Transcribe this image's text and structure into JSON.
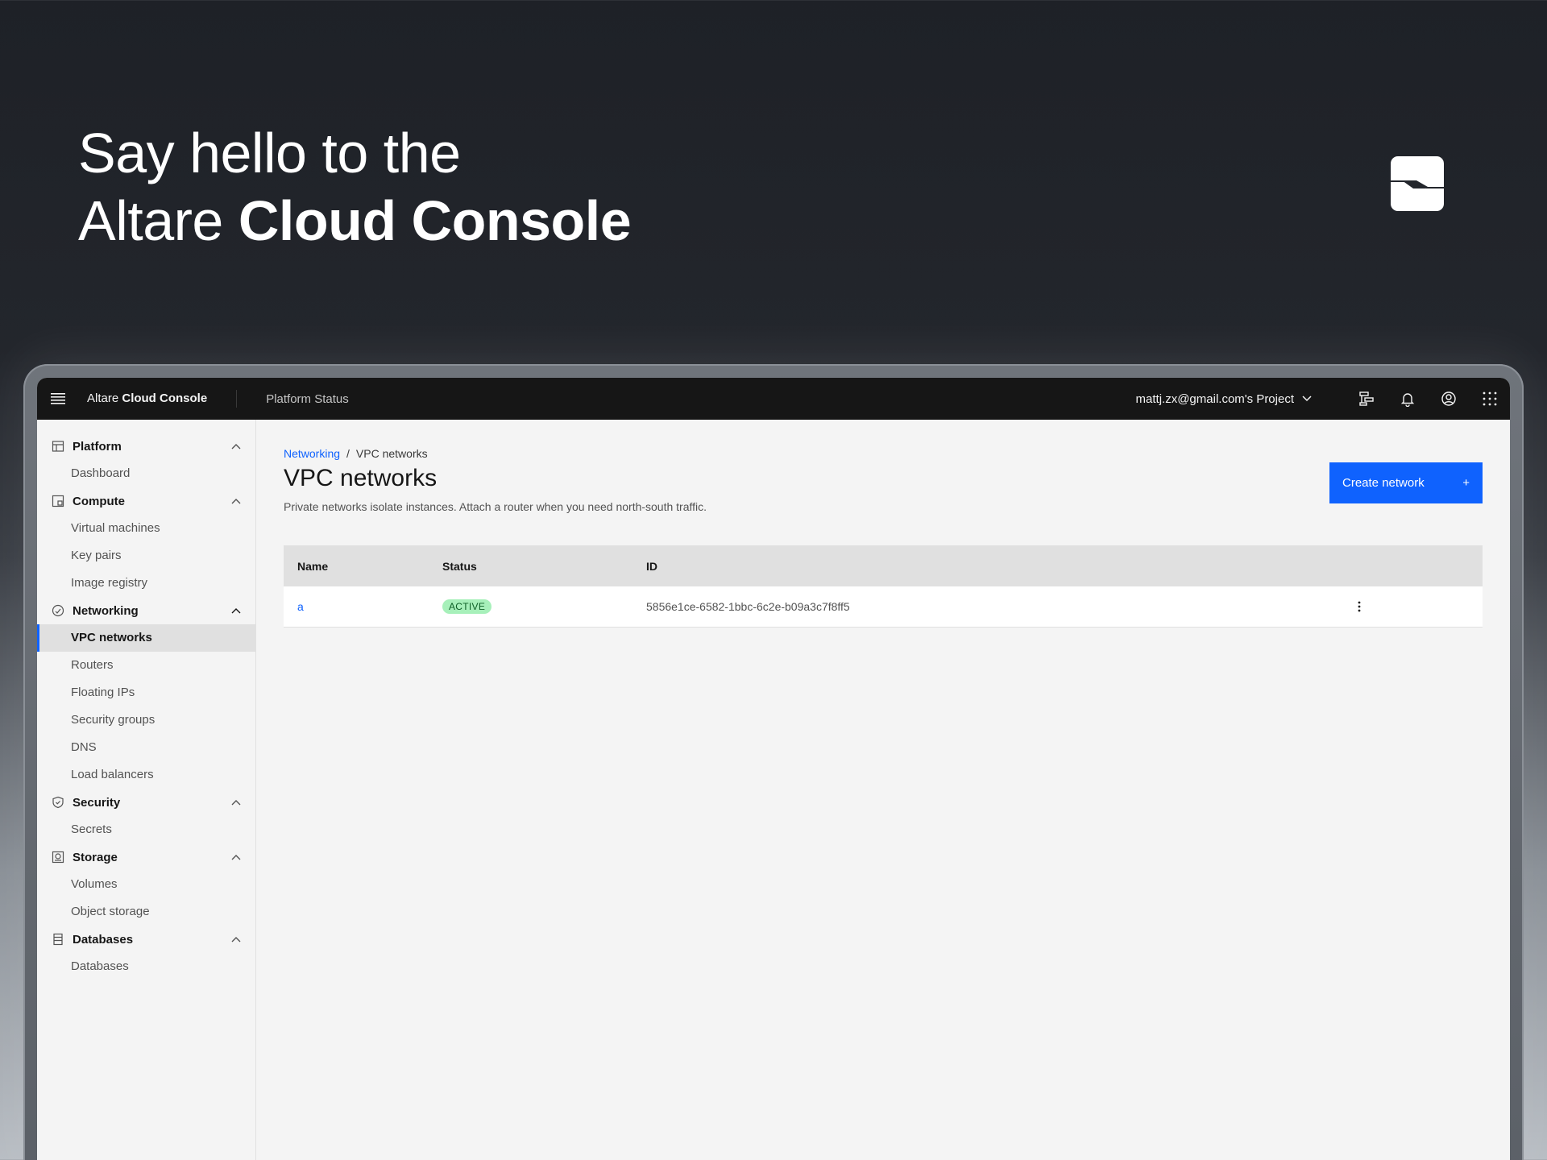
{
  "hero": {
    "line1": "Say hello to the",
    "line2_regular": "Altare ",
    "line2_bold": "Cloud Console"
  },
  "topbar": {
    "brand_regular": "Altare ",
    "brand_bold": "Cloud Console",
    "platform_status": "Platform Status",
    "project": "mattj.zx@gmail.com's Project"
  },
  "sidebar": {
    "groups": [
      {
        "label": "Platform",
        "icon": "platform-icon",
        "items": [
          "Dashboard"
        ]
      },
      {
        "label": "Compute",
        "icon": "compute-icon",
        "items": [
          "Virtual machines",
          "Key pairs",
          "Image registry"
        ]
      },
      {
        "label": "Networking",
        "icon": "networking-icon",
        "items": [
          "VPC networks",
          "Routers",
          "Floating IPs",
          "Security groups",
          "DNS",
          "Load balancers"
        ]
      },
      {
        "label": "Security",
        "icon": "security-icon",
        "items": [
          "Secrets"
        ]
      },
      {
        "label": "Storage",
        "icon": "storage-icon",
        "items": [
          "Volumes",
          "Object storage"
        ]
      },
      {
        "label": "Databases",
        "icon": "databases-icon",
        "items": [
          "Databases"
        ]
      }
    ],
    "active_item": "VPC networks"
  },
  "main": {
    "breadcrumb_link": "Networking",
    "breadcrumb_sep": "/",
    "breadcrumb_current": "VPC networks",
    "title": "VPC networks",
    "description": "Private networks isolate instances. Attach a router when you need north-south traffic.",
    "create_button": "Create network",
    "create_button_icon": "+"
  },
  "table": {
    "headers": [
      "Name",
      "Status",
      "ID"
    ],
    "rows": [
      {
        "name": "a",
        "status": "ACTIVE",
        "id": "5856e1ce-6582-1bbc-6c2e-b09a3c7f8ff5"
      }
    ]
  },
  "colors": {
    "accent": "#0f62fe",
    "topbar": "#161616",
    "active_badge_bg": "#a7f0ba",
    "active_badge_text": "#0e6027"
  }
}
